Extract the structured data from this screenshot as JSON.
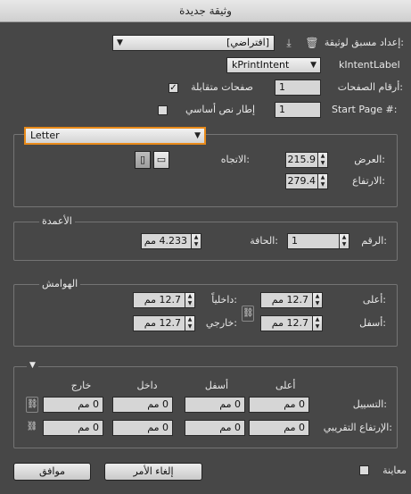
{
  "window": {
    "title": "وثيقة جديدة"
  },
  "top": {
    "preset_label": ":إعداد مسبق لوثيقة",
    "preset_value": "[افتراضي]",
    "intent_label": "kIntentLabel",
    "intent_value": "kPrintIntent",
    "pages_label": ":أرقام الصفحات",
    "pages_value": "1",
    "facing_label": "صفحات متقابلة",
    "facing_checked": true,
    "start_label": "Start Page #:",
    "start_value": "1",
    "master_label": "إطار نص أساسي",
    "master_checked": false
  },
  "page_size": {
    "value": "Letter",
    "width_label": ":العرض",
    "width_value": "215.9 مم",
    "height_label": ":الارتفاع",
    "height_value": "279.4 مم",
    "orientation_label": ":الاتجاه"
  },
  "columns": {
    "title": "الأعمدة",
    "number_label": ":الرقم",
    "number_value": "1",
    "gutter_label": ":الحافة",
    "gutter_value": "4.233 مم"
  },
  "margins": {
    "title": "الهوامش",
    "top_label": ":أعلى",
    "top_value": "12.7 مم",
    "bottom_label": ":أسفل",
    "bottom_value": "12.7 مم",
    "inside_label": ":داخلياً",
    "inside_value": "12.7 مم",
    "outside_label": ":خارجي",
    "outside_value": "12.7 مم"
  },
  "bleed": {
    "col_top": "أعلى",
    "col_bottom": "أسفل",
    "col_inside": "داخل",
    "col_outside": "خارج",
    "bleed_label": ":التسييل",
    "slug_label": ":الإرتفاع التقريبي",
    "bleed_top": "0 مم",
    "bleed_bottom": "0 مم",
    "bleed_inside": "0 مم",
    "bleed_outside": "0 مم",
    "slug_top": "0 مم",
    "slug_bottom": "0 مم",
    "slug_inside": "0 مم",
    "slug_outside": "0 مم"
  },
  "footer": {
    "preview_label": "معاينة",
    "preview_checked": false,
    "cancel_label": "إلغاء الأمر",
    "ok_label": "موافق"
  },
  "icons": {
    "trash": "trash-icon",
    "save_preset": "save-preset-icon",
    "portrait": "portrait-icon",
    "landscape": "landscape-icon",
    "link": "link-icon"
  }
}
